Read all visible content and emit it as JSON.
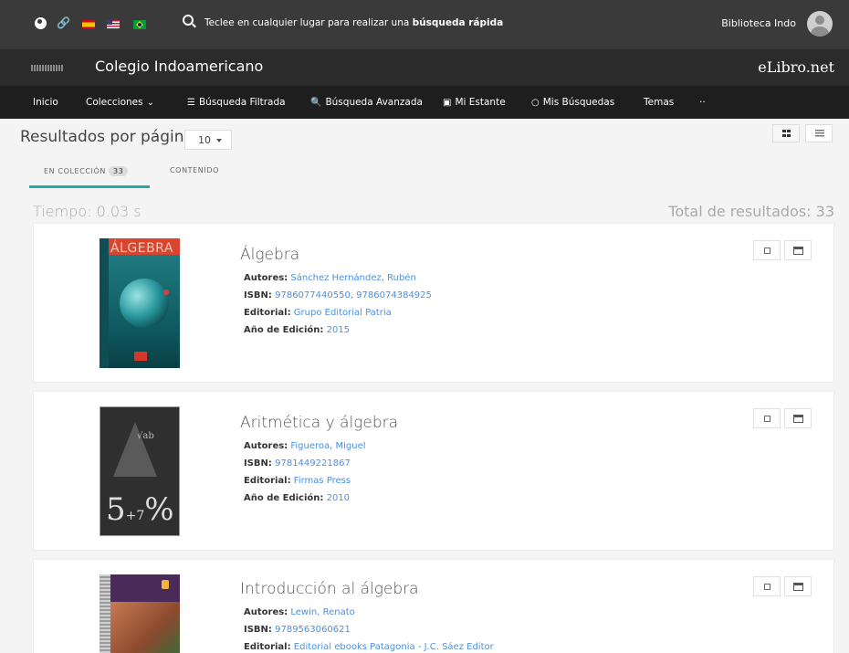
{
  "topbar": {
    "quick_search_prefix": "Teclee en cualquier lugar para realizar una ",
    "quick_search_bold": "búsqueda rápida",
    "user_name": "Biblioteca Indo"
  },
  "institution": {
    "name": "Colegio Indoamericano",
    "brand": "eLibro.net"
  },
  "nav": {
    "items": [
      {
        "label": "Inicio"
      },
      {
        "label": "Colecciones"
      },
      {
        "label": "Búsqueda Filtrada"
      },
      {
        "label": "Búsqueda Avanzada"
      },
      {
        "label": "Mi Estante"
      },
      {
        "label": "Mis Búsquedas"
      },
      {
        "label": "Temas"
      },
      {
        "label": "··"
      }
    ]
  },
  "controls": {
    "per_page_label": "Resultados por página:",
    "per_page_value": "10"
  },
  "tabs": {
    "collection_label": "EN COLECCIÓN",
    "collection_count": "33",
    "content_label": "CONTENIDO"
  },
  "summary": {
    "time": "Tiempo: 0.03 s",
    "total": "Total de resultados: 33"
  },
  "labels": {
    "authors": "Autores:",
    "isbn": "ISBN:",
    "publisher": "Editorial:",
    "year": "Año de Edición:"
  },
  "books": [
    {
      "title": "Álgebra",
      "authors": "Sánchez Hernández, Rubén",
      "isbn": "9786077440550, 9786074384925",
      "publisher": "Grupo Editorial Patria",
      "year": "2015",
      "cover_text": "ÁLGEBRA"
    },
    {
      "title": "Aritmética y álgebra",
      "authors": "Figueroa, Miguel",
      "isbn": "9781449221867",
      "publisher": "Firmas Press",
      "year": "2010",
      "cover_text_a": "√ab",
      "cover_text_b": "5",
      "cover_text_c": "+7",
      "cover_text_d": "%"
    },
    {
      "title": "Introducción al álgebra",
      "authors": "Lewin, Renato",
      "isbn": "9789563060621",
      "publisher": "Editorial ebooks Patagonia - J.C. Sáez Editor"
    }
  ]
}
